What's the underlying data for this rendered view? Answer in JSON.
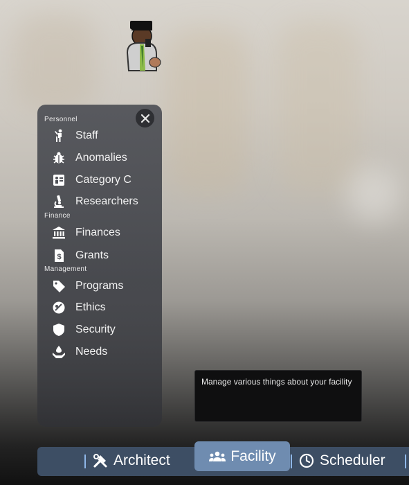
{
  "panel": {
    "sections": [
      {
        "label": "Personnel"
      },
      {
        "label": "Finance"
      },
      {
        "label": "Management"
      }
    ],
    "items": [
      {
        "label": "Staff",
        "icon": "staff-icon"
      },
      {
        "label": "Anomalies",
        "icon": "bug-icon"
      },
      {
        "label": "Category C",
        "icon": "id-card-icon"
      },
      {
        "label": "Researchers",
        "icon": "microscope-icon"
      },
      {
        "label": "Finances",
        "icon": "bank-icon"
      },
      {
        "label": "Grants",
        "icon": "dollar-document-icon"
      },
      {
        "label": "Programs",
        "icon": "tag-icon"
      },
      {
        "label": "Ethics",
        "icon": "ethics-icon"
      },
      {
        "label": "Security",
        "icon": "shield-icon"
      },
      {
        "label": "Needs",
        "icon": "hand-drop-icon"
      }
    ]
  },
  "tooltip": {
    "text": "Manage various things about your facility"
  },
  "bottom_bar": {
    "tabs": [
      {
        "label": "Architect",
        "icon": "tools-icon"
      },
      {
        "label": "Facility",
        "icon": "group-icon",
        "active": true
      },
      {
        "label": "Scheduler",
        "icon": "clock-icon"
      }
    ]
  },
  "colors": {
    "panel_bg": "#4e5056",
    "bottom_bar_bg": "#3d4e64",
    "active_tab_bg": "#6f8cb0",
    "divider": "#8fb7e8",
    "tooltip_bg": "#0f0f10"
  }
}
